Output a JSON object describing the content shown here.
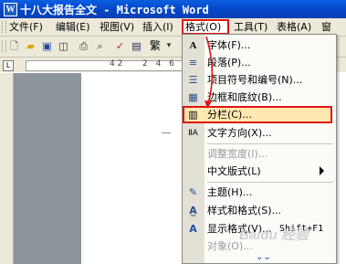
{
  "window": {
    "title": "十八大报告全文 - Microsoft Word",
    "app_icon": "W"
  },
  "menubar": {
    "items": [
      {
        "label": "文件(F)"
      },
      {
        "label": "编辑(E)"
      },
      {
        "label": "视图(V)"
      },
      {
        "label": "插入(I)"
      },
      {
        "label": "格式(O)"
      },
      {
        "label": "工具(T)"
      },
      {
        "label": "表格(A)"
      },
      {
        "label": "窗"
      }
    ]
  },
  "toolbar": {
    "style_box": "繁",
    "zoom_glyph": "▾"
  },
  "ruler": {
    "marks": "4 2",
    "marks2": "2 4 6 8"
  },
  "format_menu": {
    "items": [
      {
        "icon": "A",
        "label": "字体(F)...",
        "shortcut": ""
      },
      {
        "icon": "≡",
        "label": "段落(P)...",
        "shortcut": ""
      },
      {
        "icon": "☰",
        "label": "项目符号和编号(N)...",
        "shortcut": ""
      },
      {
        "icon": "▦",
        "label": "边框和底纹(B)...",
        "shortcut": ""
      },
      {
        "icon": "▥",
        "label": "分栏(C)...",
        "shortcut": ""
      },
      {
        "icon": "ⅡA",
        "label": "文字方向(X)...",
        "shortcut": ""
      },
      {
        "icon": "",
        "label": "调整宽度(I)...",
        "shortcut": ""
      },
      {
        "icon": "",
        "label": "中文版式(L)",
        "shortcut": ""
      },
      {
        "icon": "✎",
        "label": "主题(H)...",
        "shortcut": ""
      },
      {
        "icon": "A̲",
        "label": "样式和格式(S)...",
        "shortcut": ""
      },
      {
        "icon": "A",
        "label": "显示格式(V)...",
        "shortcut": "Shift+F1"
      },
      {
        "icon": "",
        "label": "对象(O)...",
        "shortcut": ""
      }
    ],
    "expand_glyph": "⌄⌄"
  },
  "watermark": "Baidu 经验",
  "colors": {
    "titlebar": "#0a5fe0",
    "highlight_border": "#e01414",
    "highlight_fill": "#fde8b0"
  }
}
